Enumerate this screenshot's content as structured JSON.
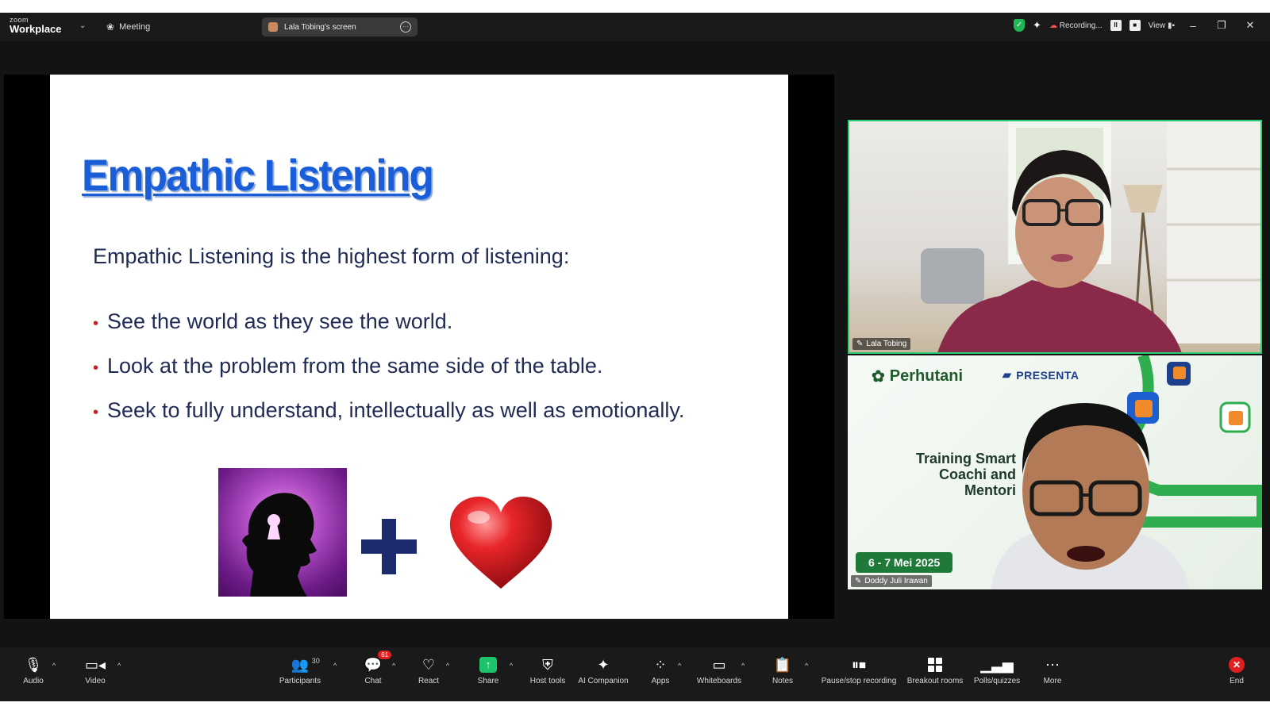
{
  "titlebar": {
    "logo_small": "zoom",
    "logo_big": "Workplace",
    "meeting_label": "Meeting",
    "screen_pill": "Lala Tobing's screen",
    "recording_label": "Recording...",
    "view_label": "View"
  },
  "slide": {
    "title": "Empathic Listening",
    "intro": "Empathic Listening is the highest form of listening:",
    "bullets": [
      "See the world as they see the world.",
      "Look at the problem from the same side of the table.",
      "Seek to fully understand, intellectually as well as emotionally."
    ]
  },
  "participants": [
    {
      "name": "Lala Tobing",
      "active_speaker": true
    },
    {
      "name": "Doddy Juli Irawan",
      "active_speaker": false
    }
  ],
  "banner": {
    "brand1": "Perhutani",
    "brand2": "PRESENTA",
    "training": "Training Smart Coachi and Mentori",
    "date": "6 - 7 Mei 2025"
  },
  "toolbar": {
    "audio": "Audio",
    "video": "Video",
    "participants": "Participants",
    "participants_count": "30",
    "chat": "Chat",
    "chat_badge": "61",
    "react": "React",
    "share": "Share",
    "host_tools": "Host tools",
    "ai_companion": "AI Companion",
    "apps": "Apps",
    "whiteboards": "Whiteboards",
    "notes": "Notes",
    "pause_recording": "Pause/stop recording",
    "breakout_rooms": "Breakout rooms",
    "polls": "Polls/quizzes",
    "more": "More",
    "end": "End"
  },
  "colors": {
    "title_blue": "#1a5dd8",
    "text_navy": "#1f2a55",
    "bullet_red": "#c0282a",
    "share_green": "#1ec26a",
    "end_red": "#e02020",
    "speaker_border": "#2ecc71"
  }
}
